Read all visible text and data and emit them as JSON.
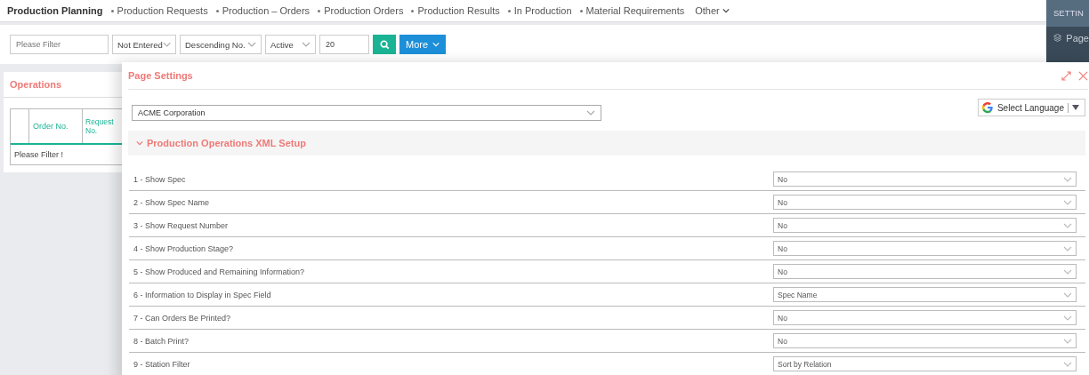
{
  "nav": {
    "title": "Production Planning",
    "items": [
      "Production Requests",
      "Production – Orders",
      "Production Orders",
      "Production Results",
      "In Production",
      "Material Requirements"
    ],
    "other": "Other"
  },
  "filters": {
    "search": {
      "placeholder": "Please Filter"
    },
    "selects": [
      "Not Entered",
      "Descending No.",
      "Active"
    ],
    "count": "20",
    "more": "More"
  },
  "operations": {
    "title": "Operations",
    "columns": [
      "Order No.",
      "Request No."
    ],
    "empty": "Please Filter !"
  },
  "side_panel": {
    "title": "SETTIN",
    "items": [
      "Page"
    ]
  },
  "modal": {
    "title": "Page Settings",
    "company": "ACME Corporation",
    "language": "Select Language",
    "section": {
      "title": "Production Operations XML Setup",
      "expanded": true
    },
    "settings": [
      {
        "label": "1 - Show Spec",
        "value": "No"
      },
      {
        "label": "2 - Show Spec Name",
        "value": "No"
      },
      {
        "label": "3 - Show Request Number",
        "value": "No"
      },
      {
        "label": "4 - Show Production Stage?",
        "value": "No"
      },
      {
        "label": "5 - Show Produced and Remaining Information?",
        "value": "No"
      },
      {
        "label": "6 - Information to Display in Spec Field",
        "value": "Spec Name"
      },
      {
        "label": "7 - Can Orders Be Printed?",
        "value": "No"
      },
      {
        "label": "8 - Batch Print?",
        "value": "No"
      },
      {
        "label": "9 - Station Filter",
        "value": "Sort by Relation"
      }
    ]
  }
}
